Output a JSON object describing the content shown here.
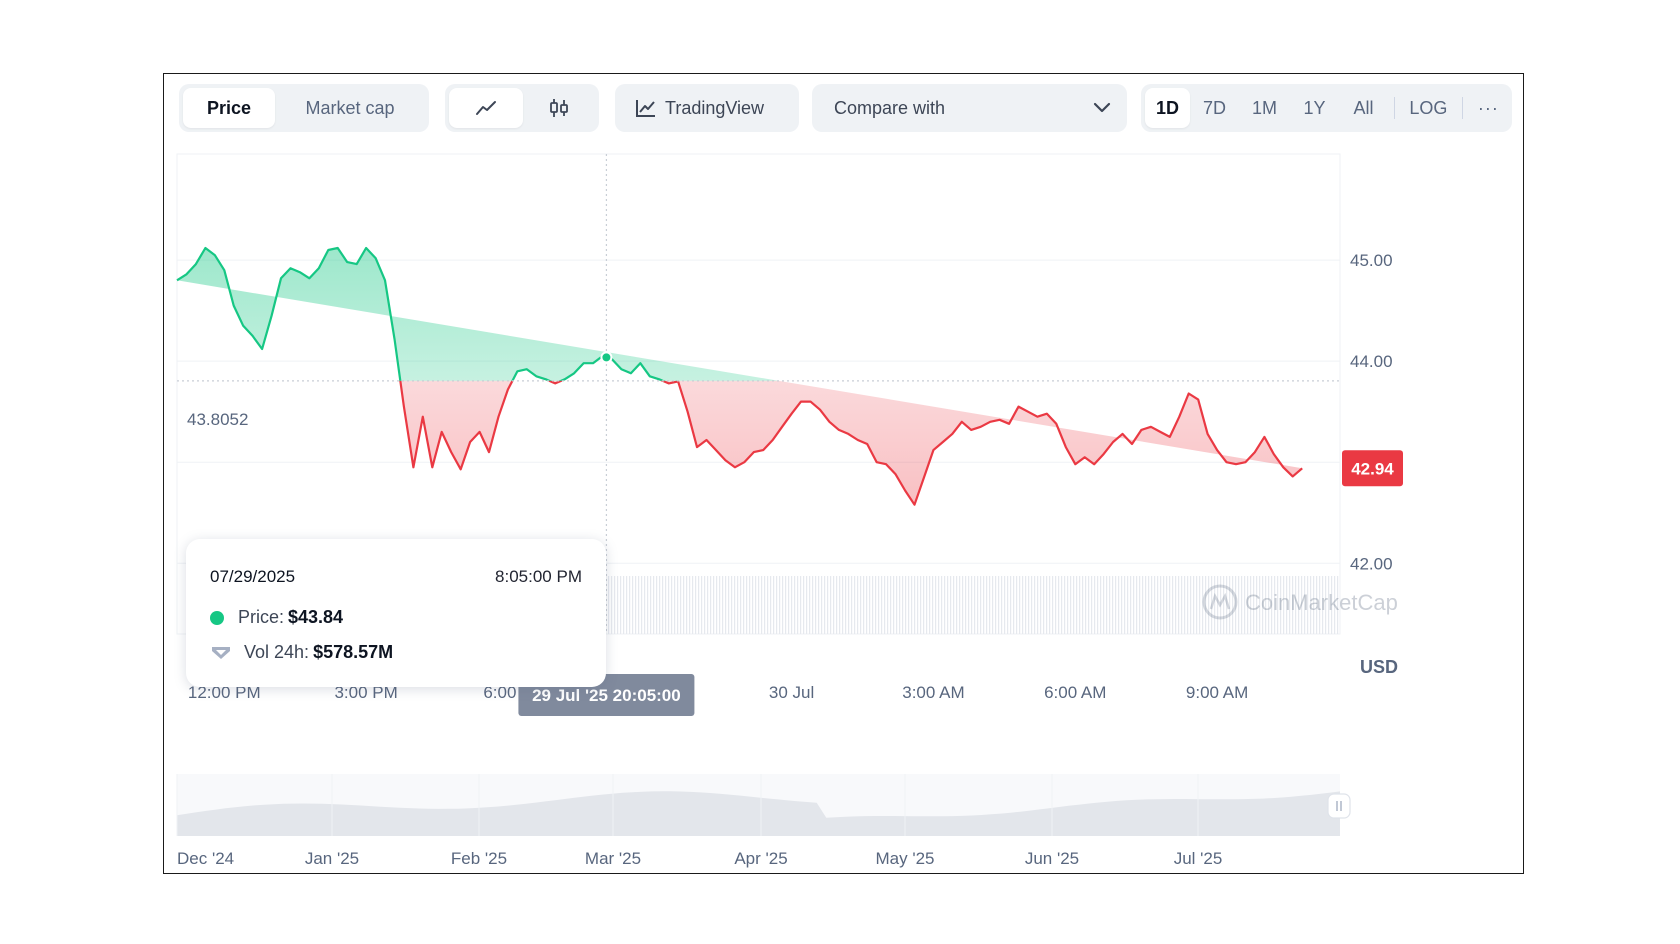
{
  "toolbar": {
    "metric_tabs": [
      "Price",
      "Market cap"
    ],
    "active_metric": "Price",
    "chart_type_icons": [
      "line-chart-icon",
      "candlestick-icon"
    ],
    "tradingview_label": "TradingView",
    "compare_label": "Compare with",
    "ranges": [
      "1D",
      "7D",
      "1M",
      "1Y",
      "All"
    ],
    "active_range": "1D",
    "log_label": "LOG",
    "more_label": "···"
  },
  "tooltip": {
    "date": "07/29/2025",
    "time": "8:05:00 PM",
    "price_label": "Price:",
    "price_value": "$43.84",
    "vol_label": "Vol 24h:",
    "vol_value": "$578.57M"
  },
  "watermark": "CoinMarketCap",
  "crosshair_label": "29 Jul '25 20:05:00",
  "colors": {
    "up": "#16c784",
    "down": "#ea3943",
    "current_bg": "#ea3943"
  },
  "chart_data": {
    "type": "line",
    "reference_value": 43.8052,
    "reference_label": "43.8052",
    "current_value": 42.94,
    "current_label": "42.94",
    "ylabel": "USD",
    "y_ticks": [
      45.0,
      44.0,
      42.0
    ],
    "y_tick_labels": [
      "45.00",
      "44.00",
      "42.00"
    ],
    "ylim": [
      41.3,
      46.05
    ],
    "xlim": [
      11.0,
      35.6
    ],
    "x_ticks": [
      12,
      15,
      18,
      24,
      27,
      30,
      33
    ],
    "x_tick_labels": [
      "12:00 PM",
      "3:00 PM",
      "6:00 P",
      "30 Jul",
      "3:00 AM",
      "6:00 AM",
      "9:00 AM"
    ],
    "x_unit_note": "hours since 00:00 on 29 Jul 2025",
    "hover_x": 20.083,
    "x": [
      11.0,
      11.2,
      11.4,
      11.6,
      11.8,
      12.0,
      12.2,
      12.4,
      12.6,
      12.8,
      13.0,
      13.2,
      13.4,
      13.6,
      13.8,
      14.0,
      14.2,
      14.4,
      14.6,
      14.8,
      15.0,
      15.2,
      15.4,
      15.6,
      15.8,
      16.0,
      16.2,
      16.4,
      16.6,
      16.8,
      17.0,
      17.2,
      17.4,
      17.6,
      17.8,
      18.0,
      18.2,
      18.4,
      18.6,
      18.8,
      19.0,
      19.2,
      19.4,
      19.6,
      19.8,
      20.0,
      20.2,
      20.4,
      20.6,
      20.8,
      21.0,
      21.2,
      21.4,
      21.6,
      21.8,
      22.0,
      22.2,
      22.4,
      22.6,
      22.8,
      23.0,
      23.2,
      23.4,
      23.6,
      23.8,
      24.0,
      24.2,
      24.4,
      24.6,
      24.8,
      25.0,
      25.2,
      25.4,
      25.6,
      25.8,
      26.0,
      26.2,
      26.4,
      26.6,
      26.8,
      27.0,
      27.2,
      27.4,
      27.6,
      27.8,
      28.0,
      28.2,
      28.4,
      28.6,
      28.8,
      29.0,
      29.2,
      29.4,
      29.6,
      29.8,
      30.0,
      30.2,
      30.4,
      30.6,
      30.8,
      31.0,
      31.2,
      31.4,
      31.6,
      31.8,
      32.0,
      32.2,
      32.4,
      32.6,
      32.8,
      33.0,
      33.2,
      33.4,
      33.6,
      33.8,
      34.0,
      34.2,
      34.4,
      34.6,
      34.8,
      35.0,
      35.2,
      35.4,
      35.6
    ],
    "values": [
      44.8,
      44.86,
      44.96,
      45.12,
      45.05,
      44.9,
      44.55,
      44.35,
      44.25,
      44.12,
      44.45,
      44.82,
      44.92,
      44.88,
      44.82,
      44.92,
      45.1,
      45.12,
      44.98,
      44.96,
      45.12,
      45.02,
      44.8,
      44.22,
      43.55,
      42.95,
      43.45,
      42.95,
      43.3,
      43.1,
      42.93,
      43.2,
      43.3,
      43.1,
      43.45,
      43.72,
      43.9,
      43.92,
      43.85,
      43.82,
      43.78,
      43.82,
      43.88,
      43.98,
      43.98,
      44.05,
      44.02,
      43.92,
      43.88,
      43.98,
      43.85,
      43.82,
      43.78,
      43.8,
      43.5,
      43.15,
      43.22,
      43.12,
      43.02,
      42.95,
      43.0,
      43.1,
      43.12,
      43.22,
      43.35,
      43.48,
      43.6,
      43.6,
      43.52,
      43.4,
      43.32,
      43.28,
      43.22,
      43.18,
      43.0,
      42.98,
      42.88,
      42.72,
      42.58,
      42.85,
      43.12,
      43.2,
      43.28,
      43.4,
      43.32,
      43.35,
      43.4,
      43.42,
      43.38,
      43.55,
      43.5,
      43.45,
      43.48,
      43.38,
      43.15,
      42.98,
      43.05,
      42.98,
      43.08,
      43.2,
      43.28,
      43.18,
      43.32,
      43.35,
      43.3,
      43.25,
      43.45,
      43.68,
      43.62,
      43.28,
      43.12,
      43.0,
      42.98,
      43.0,
      43.1,
      43.25,
      43.08,
      42.95,
      42.86,
      42.94
    ],
    "navigator_x_labels": [
      "Dec '24",
      "Jan '25",
      "Feb '25",
      "Mar '25",
      "Apr '25",
      "May '25",
      "Jun '25",
      "Jul '25"
    ]
  }
}
